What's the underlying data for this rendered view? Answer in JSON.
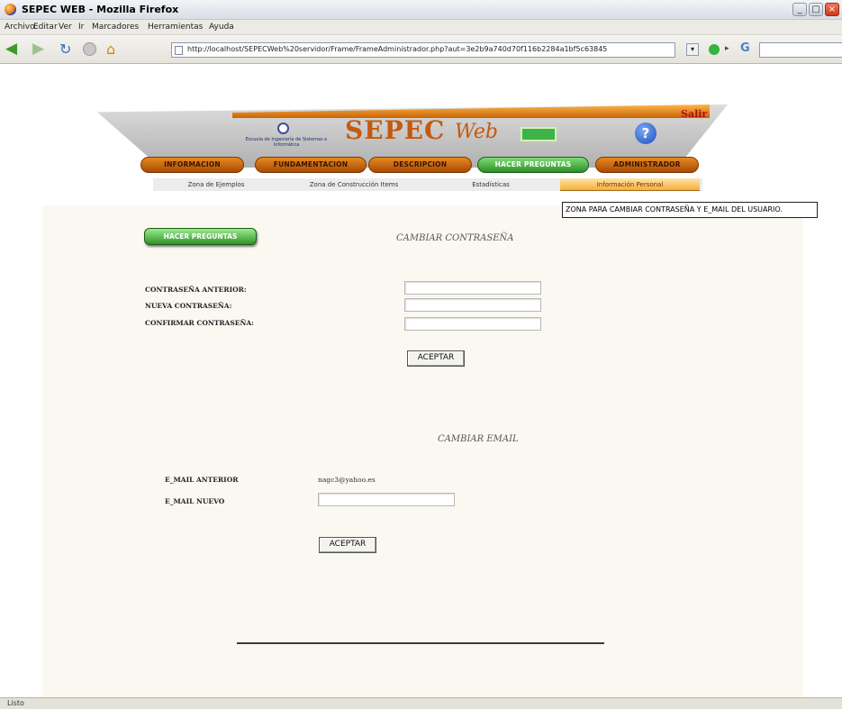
{
  "window": {
    "title": "SEPEC WEB - Mozilla Firefox"
  },
  "menu": [
    "Archivo",
    "Editar",
    "Ver",
    "Ir",
    "Marcadores",
    "Herramientas",
    "Ayuda"
  ],
  "navbar": {
    "url": "http://localhost/SEPECWeb%20servidor/Frame/FrameAdministrador.php?aut=3e2b9a740d70f116b2284a1bf5c63845",
    "back_icon": "back-arrow-icon",
    "forward_icon": "forward-arrow-icon",
    "reload_icon": "reload-icon",
    "stop_icon": "stop-icon",
    "home_icon": "home-icon"
  },
  "banner": {
    "school": "Escuela de Ingeniería de Sistemas e Informática",
    "brand_main": "SEPEC",
    "brand_web": "Web",
    "salir": "Salir",
    "help": "?"
  },
  "tabs": [
    "INFORMACION",
    "FUNDAMENTACION",
    "DESCRIPCION",
    "HACER PREGUNTAS",
    "ADMINISTRADOR"
  ],
  "subtabs": [
    "Zona de Ejemplos",
    "Zona de Construcción Items",
    "Estadísticas",
    "Información Personal"
  ],
  "tooltip": "ZONA PARA CAMBIAR CONTRASEÑA Y E_MAIL DEL USUARIO.",
  "panel": {
    "hacer_preguntas": "HACER PREGUNTAS",
    "password_section": {
      "title": "CAMBIAR CONTRASEÑA",
      "old_label": "CONTRASEÑA ANTERIOR:",
      "new_label": "NUEVA CONTRASEÑA:",
      "confirm_label": "CONFIRMAR CONTRASEÑA:",
      "accept": "ACEPTAR"
    },
    "email_section": {
      "title": "CAMBIAR EMAIL",
      "old_label": "E_MAIL ANTERIOR",
      "old_value": "nagc3@yahoo.es",
      "new_label": "E_MAIL NUEVO",
      "accept": "ACEPTAR"
    }
  },
  "status": "Listo",
  "colors": {
    "accent_orange": "#d9751a",
    "active_green": "#3aa333",
    "panel_bg": "#fbf8f1"
  }
}
